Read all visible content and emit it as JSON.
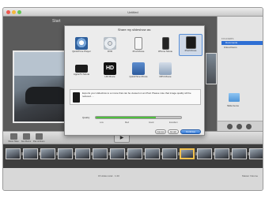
{
  "window": {
    "title": "Untitled"
  },
  "stage": {
    "slide_label": "Start"
  },
  "dialog": {
    "title": "Share my slideshow as:",
    "options": [
      {
        "label": "QuickTime Player",
        "icon": "quicktime-icon"
      },
      {
        "label": "DVD",
        "icon": "dvd-disc-icon"
      },
      {
        "label": "iPod Movie",
        "icon": "ipod-icon"
      },
      {
        "label": "iPhone Movie",
        "icon": "iphone-icon"
      },
      {
        "label": "iPad Movie",
        "icon": "ipad-icon",
        "selected": true
      },
      {
        "label": "AppleTV Movie",
        "icon": "appletv-icon"
      },
      {
        "label": "HD Movie",
        "icon": "hd-icon"
      },
      {
        "label": "QuickTime Movie",
        "icon": "quicktime-movie-icon"
      },
      {
        "label": "MP4 Movie",
        "icon": "mp4-icon"
      }
    ],
    "info_text": "Exports your slideshow to a movie that can be viewed on an iPad. Please note that image quality will be reduced. ...",
    "quality": {
      "label": "Quality",
      "value": 0.7,
      "ticks": [
        "Low",
        "Med",
        "Good",
        "Excellent"
      ]
    },
    "buttons": {
      "cancel": "Cancel",
      "email": "Email",
      "continue": "Continue"
    }
  },
  "sidebar": {
    "header": "FOLDERS",
    "selected_item": "Documents",
    "sub_item": "iCloud Items",
    "folder_label": "Slide Items"
  },
  "toolbar": {
    "buttons": [
      "Show Titles",
      "Ken Burns",
      "Pan & Zoom"
    ],
    "play": "▶"
  },
  "filmstrip": {
    "frame_count": 15,
    "selected_index": 10
  },
  "status": {
    "center": "15 slides total · 1:20",
    "right": "Master Volume"
  },
  "colors": {
    "accent": "#2e6fd4",
    "quality_fill": "#4ebf3d",
    "selected_frame": "#f2c14e"
  }
}
